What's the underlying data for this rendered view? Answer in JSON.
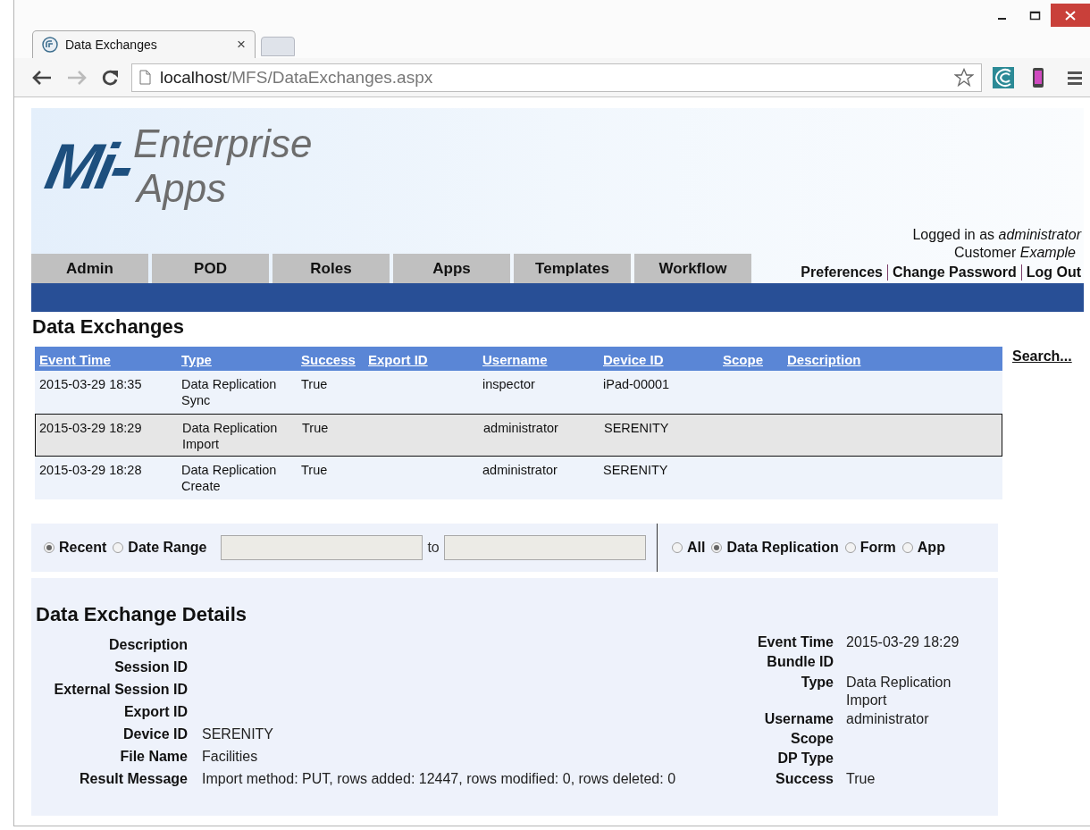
{
  "browser": {
    "tab": {
      "title": "Data Exchanges",
      "close": "×"
    },
    "url": {
      "host": "localhost",
      "path": "/MFS/DataExchanges.aspx"
    }
  },
  "logo": {
    "mark": "Mi-",
    "line1": "Enterprise",
    "line2": "Apps"
  },
  "user_info": {
    "logged_in": "Logged in as *administrator*",
    "customer": "Customer *Example*",
    "links": [
      "Preferences",
      "Change Password",
      "Log Out"
    ]
  },
  "nav_tabs": [
    "Admin",
    "POD",
    "Roles",
    "Apps",
    "Templates",
    "Workflow"
  ],
  "page_title": "Data Exchanges",
  "table": {
    "columns": [
      "Event Time",
      "Type",
      "Success",
      "Export ID",
      "Username",
      "Device ID",
      "Scope",
      "Description"
    ],
    "rows": [
      {
        "selected": false,
        "cells": [
          "2015-03-29 18:35",
          "Data Replication Sync",
          "True",
          "",
          "inspector",
          "iPad-00001",
          "",
          ""
        ]
      },
      {
        "selected": true,
        "cells": [
          "2015-03-29 18:29",
          "Data Replication Import",
          "True",
          "",
          "administrator",
          "SERENITY",
          "",
          ""
        ]
      },
      {
        "selected": false,
        "cells": [
          "2015-03-29 18:28",
          "Data Replication Create",
          "True",
          "",
          "administrator",
          "SERENITY",
          "",
          ""
        ]
      }
    ]
  },
  "search_link": "Search...",
  "filter": {
    "range_options": [
      {
        "label": "Recent",
        "selected": true
      },
      {
        "label": "Date Range",
        "selected": false
      }
    ],
    "to_label": "to",
    "type_options": [
      {
        "label": "All",
        "selected": false
      },
      {
        "label": "Data Replication",
        "selected": true
      },
      {
        "label": "Form",
        "selected": false
      },
      {
        "label": "App",
        "selected": false
      }
    ]
  },
  "details": {
    "title": "Data Exchange Details",
    "left": [
      {
        "label": "Description"
      },
      {
        "label": "Session ID"
      },
      {
        "label": "External Session ID"
      },
      {
        "label": "Export ID"
      },
      {
        "label": "Device ID",
        "value": "SERENITY"
      },
      {
        "label": "File Name",
        "value": "Facilities"
      },
      {
        "label": "Result Message",
        "value": "Import method: PUT, rows added: 12447, rows modified: 0, rows deleted: 0"
      }
    ],
    "right": [
      {
        "label": "Event Time",
        "value": "2015-03-29 18:29"
      },
      {
        "label": "Bundle ID"
      },
      {
        "label": "Type",
        "value": "Data Replication Import"
      },
      {
        "label": "Username",
        "value": "administrator"
      },
      {
        "label": "Scope"
      },
      {
        "label": "DP Type"
      },
      {
        "label": "Success",
        "value": "True"
      }
    ]
  }
}
